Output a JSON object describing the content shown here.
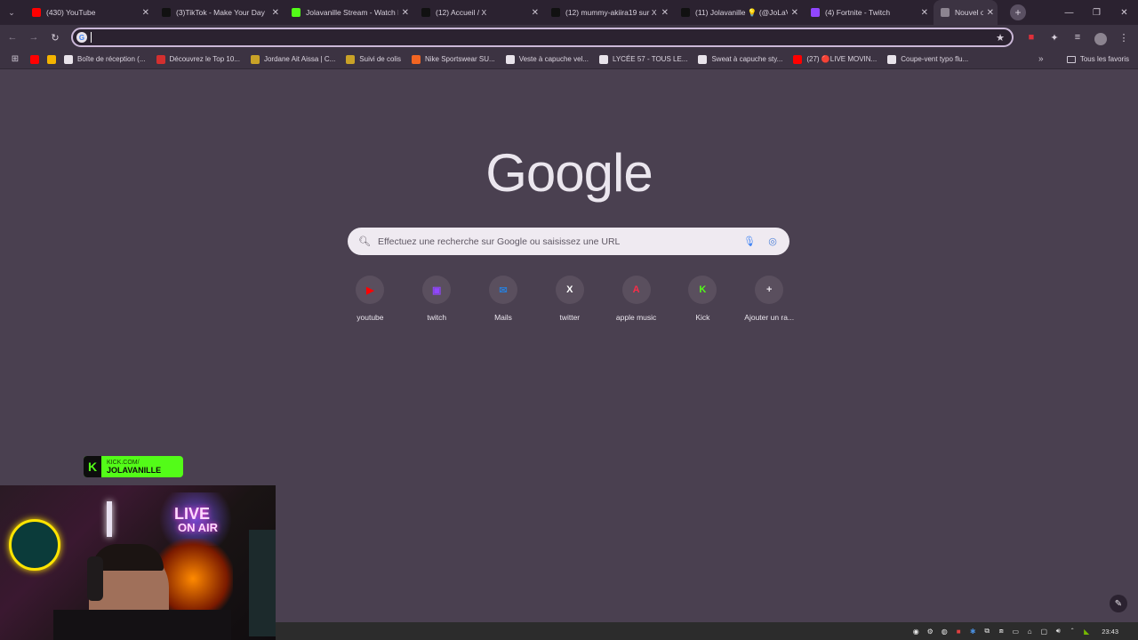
{
  "tabs": [
    {
      "title": "(430) YouTube",
      "icon": "youtube-icon",
      "color": "#ff0000"
    },
    {
      "title": "(3)TikTok - Make Your Day",
      "icon": "tiktok-icon",
      "color": "#111111"
    },
    {
      "title": "Jolavanille Stream - Watch L",
      "icon": "kick-icon",
      "color": "#53fc18"
    },
    {
      "title": "(12) Accueil / X",
      "icon": "x-icon",
      "color": "#111111"
    },
    {
      "title": "(12) mummy-akiira19 sur X",
      "icon": "x-icon",
      "color": "#111111"
    },
    {
      "title": "(11) Jolavanille 💡 (@JoLaV",
      "icon": "x-icon",
      "color": "#111111"
    },
    {
      "title": "(4) Fortnite - Twitch",
      "icon": "twitch-icon",
      "color": "#9146ff"
    },
    {
      "title": "Nouvel on",
      "icon": "chrome-icon",
      "color": "#8c8490"
    }
  ],
  "new_tab_label": "+",
  "omnibox": {
    "value": ""
  },
  "bookmarks": [
    {
      "label": "",
      "color": "#ff0000"
    },
    {
      "label": "",
      "color": "#f4b400"
    },
    {
      "label": "Boîte de réception (...",
      "color": "#e8e3ea"
    },
    {
      "label": "Découvrez le Top 10...",
      "color": "#d32f2f"
    },
    {
      "label": "Jordane Ait Aissa | C...",
      "color": "#c9a227"
    },
    {
      "label": "Suivi de colis",
      "color": "#c9a227"
    },
    {
      "label": "Nike Sportswear SU...",
      "color": "#f26522"
    },
    {
      "label": "Veste à capuche vel...",
      "color": "#e8e3ea"
    },
    {
      "label": "LYCÉE 57 - TOUS LE...",
      "color": "#e8e3ea"
    },
    {
      "label": "Sweat à capuche sty...",
      "color": "#e8e3ea"
    },
    {
      "label": "(27) 🔴LIVE MOVIN...",
      "color": "#ff0000"
    },
    {
      "label": "Coupe-vent typo flu...",
      "color": "#e8e3ea"
    }
  ],
  "bookmarks_more": "»",
  "all_bookmarks": "Tous les favoris",
  "logo": "Google",
  "search": {
    "placeholder": "Effectuez une recherche sur Google ou saisissez une URL"
  },
  "shortcuts": [
    {
      "label": "youtube",
      "glyph": "▶",
      "color": "#ff0000"
    },
    {
      "label": "twitch",
      "glyph": "▣",
      "color": "#9146ff"
    },
    {
      "label": "Mails",
      "glyph": "✉",
      "color": "#2b7cd3"
    },
    {
      "label": "twitter",
      "glyph": "X",
      "color": "#ffffff"
    },
    {
      "label": "apple music",
      "glyph": "A",
      "color": "#fa2d48"
    },
    {
      "label": "Kick",
      "glyph": "K",
      "color": "#53fc18"
    },
    {
      "label": "Ajouter un ra...",
      "glyph": "+",
      "color": "#e8e3ea"
    }
  ],
  "kick_badge": {
    "line1": "KICK.COM/",
    "line2": "JOLAVANILLE"
  },
  "webcam": {
    "sign_line1": "LIVE",
    "sign_line2": "ON AIR"
  },
  "clock": "23:43"
}
